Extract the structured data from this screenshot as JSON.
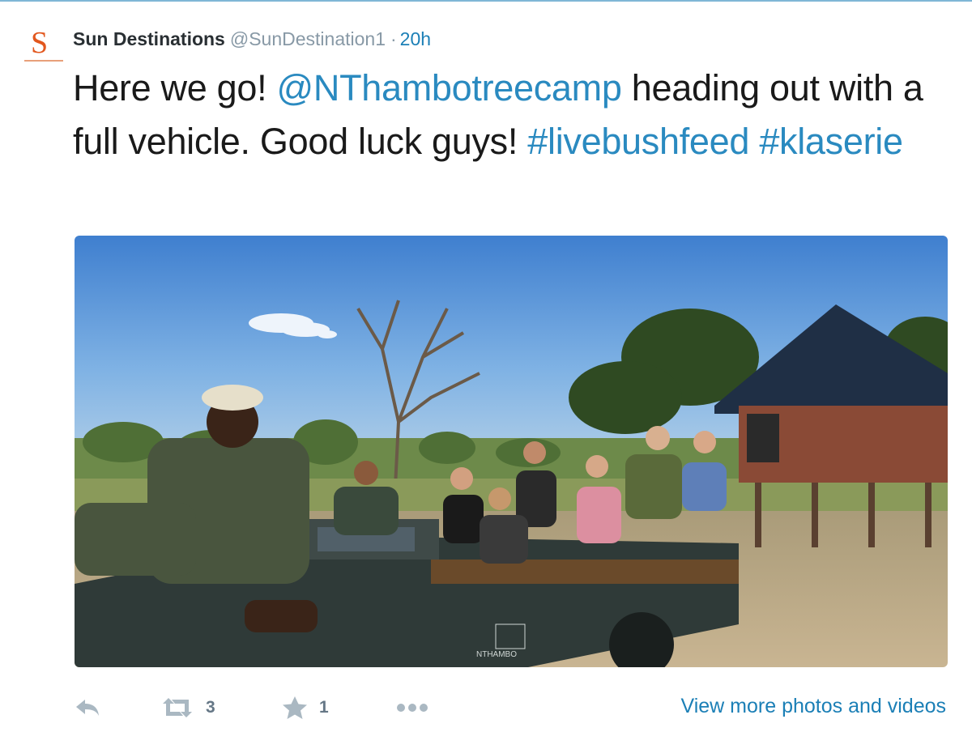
{
  "tweet": {
    "author_name": "Sun Destinations",
    "author_handle": "@SunDestination1",
    "separator": "·",
    "timestamp": "20h",
    "avatar_letter": "S",
    "text_parts": {
      "p1": "Here we go! ",
      "mention": "@NThambotreecamp",
      "p2": " heading out with a full vehicle. Good luck guys! ",
      "hashtag1": "#livebushfeed",
      "space": " ",
      "hashtag2": "#klaserie"
    },
    "media": {
      "vehicle_logo": "NTHAMBO"
    }
  },
  "actions": {
    "reply_icon": "reply-icon",
    "retweet_icon": "retweet-icon",
    "retweet_count": "3",
    "favorite_icon": "star-icon",
    "favorite_count": "1",
    "more_icon": "more-dots-icon",
    "view_more_label": "View more photos and videos"
  },
  "colors": {
    "link": "#2a8ac0",
    "accent": "#1b7fb6",
    "icon_gray": "#aab8c2",
    "brand_orange": "#e2571e"
  }
}
